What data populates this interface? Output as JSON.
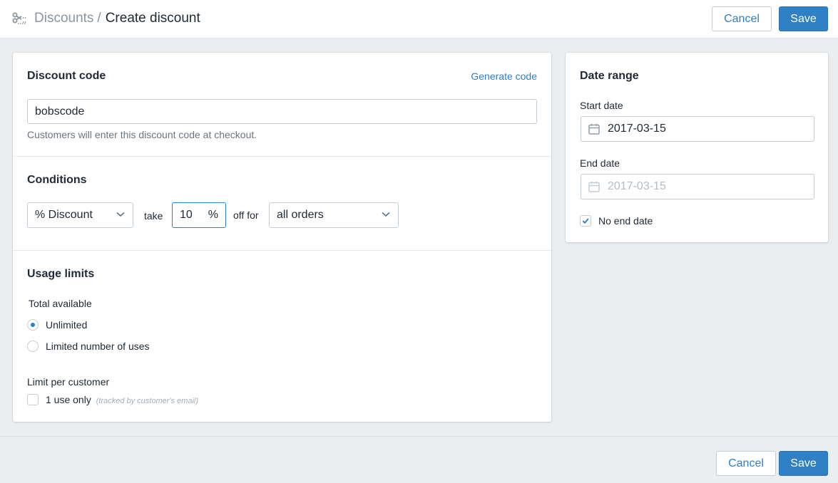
{
  "header": {
    "icon": "scissors-icon",
    "breadcrumb_parent": "Discounts",
    "breadcrumb_separator": "/",
    "page_title": "Create discount",
    "cancel_label": "Cancel",
    "save_label": "Save"
  },
  "discount_code": {
    "heading": "Discount code",
    "generate_link": "Generate code",
    "value": "bobscode",
    "help": "Customers will enter this discount code at checkout."
  },
  "conditions": {
    "heading": "Conditions",
    "discount_type": "% Discount",
    "take_label": "take",
    "amount": "10",
    "amount_unit": "%",
    "off_for_label": "off for",
    "applies_to": "all orders"
  },
  "usage_limits": {
    "heading": "Usage limits",
    "total_available_label": "Total available",
    "options": [
      {
        "label": "Unlimited",
        "selected": true
      },
      {
        "label": "Limited number of uses",
        "selected": false
      }
    ],
    "per_customer_label": "Limit per customer",
    "one_use_label": "1 use only",
    "one_use_note": "(tracked by customer's email)",
    "one_use_checked": false
  },
  "date_range": {
    "heading": "Date range",
    "start_label": "Start date",
    "start_value": "2017-03-15",
    "end_label": "End date",
    "end_value": "2017-03-15",
    "no_end_date_label": "No end date",
    "no_end_date_checked": true
  },
  "footer": {
    "cancel_label": "Cancel",
    "save_label": "Save"
  },
  "colors": {
    "accent": "#2f80c4",
    "background": "#ebeef0"
  }
}
